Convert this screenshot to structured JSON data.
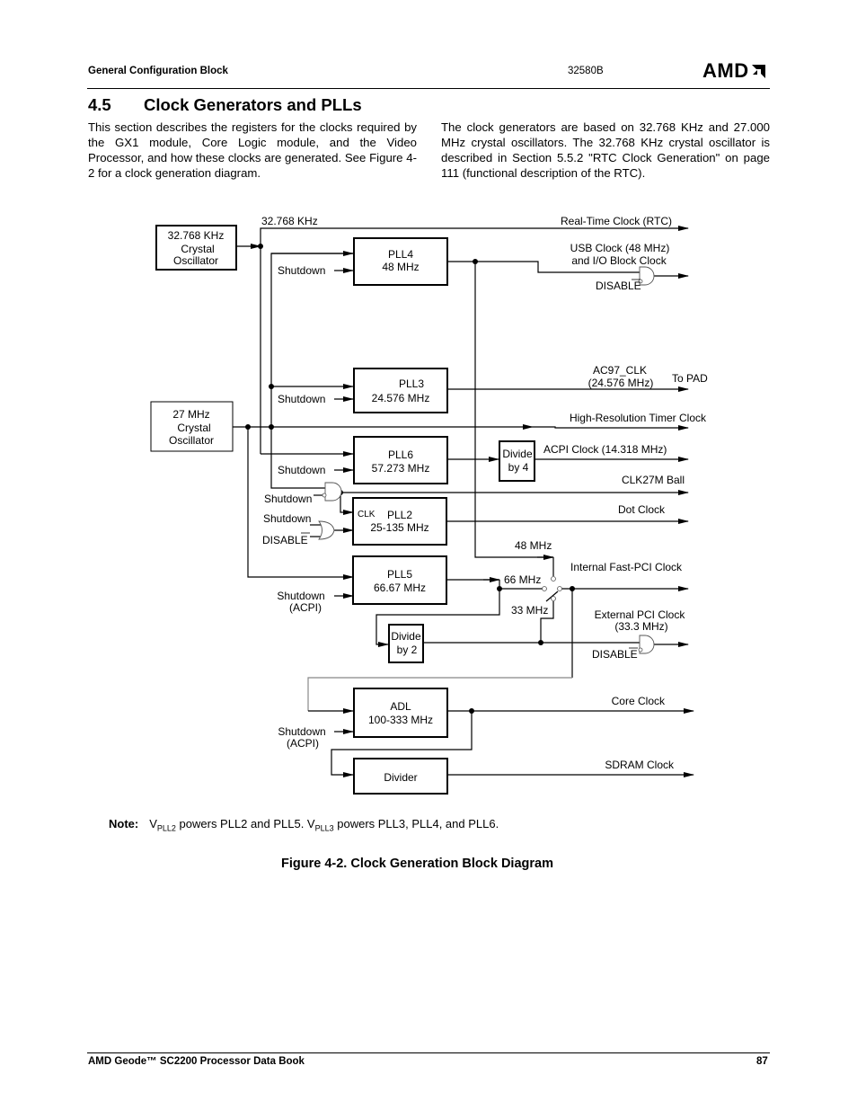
{
  "header": {
    "section_label": "General Configuration Block",
    "doc_number": "32580B",
    "logo_text": "AMD",
    "logo_icon": "amd-arrow-icon"
  },
  "section": {
    "number": "4.5",
    "title": "Clock Generators and PLLs",
    "paragraph_left": "This section describes the registers for the clocks required by the GX1 module, Core Logic module, and the Video Processor, and how these clocks are generated. See Figure 4-2 for a clock generation diagram.",
    "paragraph_right": "The clock generators are based on 32.768 KHz and 27.000 MHz crystal oscillators. The 32.768 KHz crystal oscillator is described in Section 5.5.2 \"RTC Clock Generation\" on page 111 (functional description of the RTC)."
  },
  "diagram": {
    "blocks": {
      "osc32": [
        "32.768 KHz",
        "Crystal",
        "Oscillator"
      ],
      "osc27": [
        "27 MHz",
        "Crystal",
        "Oscillator"
      ],
      "pll4": [
        "PLL4",
        "48 MHz"
      ],
      "pll3": [
        "PLL3",
        "24.576 MHz"
      ],
      "pll6": [
        "PLL6",
        "57.273 MHz"
      ],
      "pll2": [
        "PLL2",
        "25-135 MHz"
      ],
      "pll2_clk": "CLK",
      "pll5": [
        "PLL5",
        "66.67 MHz"
      ],
      "div4": [
        "Divide",
        "by 4"
      ],
      "div2": [
        "Divide",
        "by 2"
      ],
      "adl": [
        "ADL",
        "100-333 MHz"
      ],
      "divider": [
        "Divider"
      ]
    },
    "labels": {
      "freq32": "32.768 KHz",
      "shutdown": "Shutdown",
      "shutdown_acpi": [
        "Shutdown",
        "(ACPI)"
      ],
      "disable": "DISABLE",
      "mhz48": "48 MHz",
      "mhz66": "66 MHz",
      "mhz33": "33 MHz"
    },
    "outputs": {
      "rtc": "Real-Time Clock (RTC)",
      "usb": [
        "USB Clock (48 MHz)",
        "and I/O Block Clock"
      ],
      "ac97": [
        "AC97_CLK",
        "(24.576 MHz)"
      ],
      "to_pad": "To PAD",
      "hrt": "High-Resolution Timer Clock",
      "acpi": "ACPI Clock (14.318 MHz)",
      "clk27m": "CLK27M Ball",
      "dot": "Dot Clock",
      "int_pci": "Internal Fast-PCI Clock",
      "ext_pci": [
        "External PCI Clock",
        "(33.3 MHz)"
      ],
      "core": "Core Clock",
      "sdram": "SDRAM Clock"
    }
  },
  "note": {
    "label": "Note:",
    "v": "V",
    "sub1": "PLL2",
    "text1": " powers PLL2 and PLL5. ",
    "sub2": "PLL3",
    "text2": " powers PLL3, PLL4, and PLL6."
  },
  "caption": "Figure 4-2.  Clock Generation Block Diagram",
  "footer": {
    "book_title": "AMD Geode™ SC2200  Processor Data Book",
    "page_number": "87"
  }
}
